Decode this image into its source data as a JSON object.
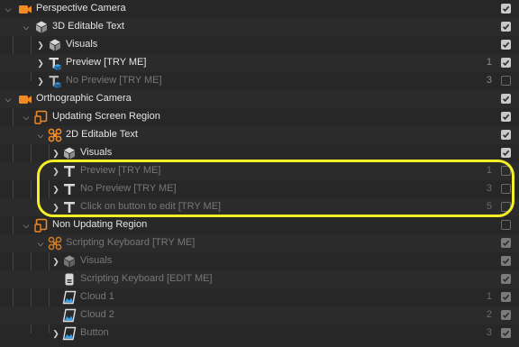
{
  "colors": {
    "highlight": "#f4ef25",
    "camera": "#f08a24",
    "blue": "#39a2ec",
    "background": "#272727"
  },
  "rows": [
    {
      "label": "Perspective Camera",
      "icon": "camera-icon",
      "count": "",
      "checked": true,
      "dim": false
    },
    {
      "label": "3D Editable Text",
      "icon": "cube-icon",
      "count": "",
      "checked": true,
      "dim": false
    },
    {
      "label": "Visuals",
      "icon": "cube-icon",
      "count": "",
      "checked": true,
      "dim": false
    },
    {
      "label": "Preview [TRY ME]",
      "icon": "text-3d-icon",
      "count": "1",
      "checked": true,
      "dim": false
    },
    {
      "label": "No Preview [TRY ME]",
      "icon": "text-3d-icon",
      "count": "3",
      "checked": false,
      "dim": true
    },
    {
      "label": "Orthographic Camera",
      "icon": "camera-icon",
      "count": "",
      "checked": true,
      "dim": false
    },
    {
      "label": "Updating Screen Region",
      "icon": "screen-region-icon",
      "count": "",
      "checked": true,
      "dim": false
    },
    {
      "label": "2D Editable Text",
      "icon": "component-icon",
      "count": "",
      "checked": true,
      "dim": false
    },
    {
      "label": "Visuals",
      "icon": "cube-icon",
      "count": "",
      "checked": true,
      "dim": false
    },
    {
      "label": "Preview [TRY ME]",
      "icon": "text-icon",
      "count": "1",
      "checked": false,
      "dim": true
    },
    {
      "label": "No Preview [TRY ME]",
      "icon": "text-icon",
      "count": "3",
      "checked": false,
      "dim": true
    },
    {
      "label": "Click on button to edit [TRY ME]",
      "icon": "text-icon",
      "count": "5",
      "checked": false,
      "dim": true
    },
    {
      "label": "Non Updating Region",
      "icon": "screen-region-icon",
      "count": "",
      "checked": false,
      "dim": false
    },
    {
      "label": "Scripting Keyboard [TRY ME]",
      "icon": "component-icon",
      "count": "",
      "checked": true,
      "dim": true
    },
    {
      "label": "Visuals",
      "icon": "cube-icon",
      "count": "",
      "checked": true,
      "dim": true
    },
    {
      "label": "Scripting Keyboard [EDIT ME]",
      "icon": "script-icon",
      "count": "",
      "checked": true,
      "dim": true
    },
    {
      "label": "Cloud 1",
      "icon": "image-icon",
      "count": "1",
      "checked": true,
      "dim": true
    },
    {
      "label": "Cloud 2",
      "icon": "image-icon",
      "count": "2",
      "checked": true,
      "dim": true
    },
    {
      "label": "Button",
      "icon": "image-icon",
      "count": "3",
      "checked": true,
      "dim": true
    }
  ]
}
